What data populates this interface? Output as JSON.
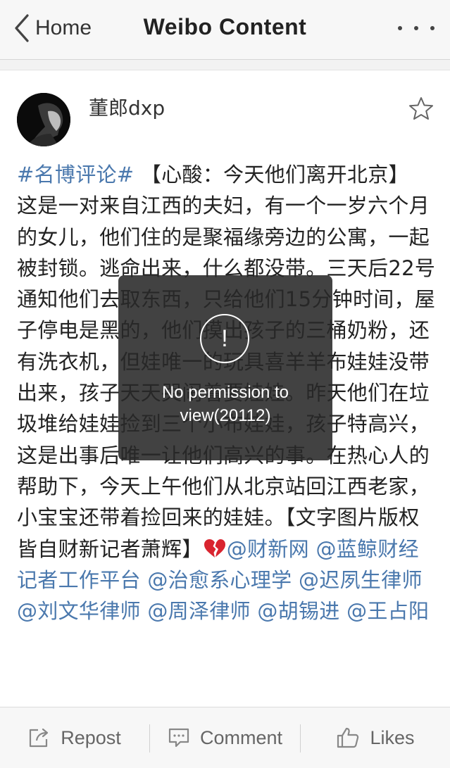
{
  "nav": {
    "back_label": "Home",
    "title": "Weibo Content",
    "more_icon": "more-dots-icon"
  },
  "post": {
    "username": "董郎dxp",
    "hashtag": "#名博评论#",
    "headline": " 【心酸：今天他们离开北京】",
    "body": "这是一对来自江西的夫妇，有一个一岁六个月的女儿，他们住的是聚福缘旁边的公寓，一起被封锁。逃命出来，什么都没带。三天后22号通知他们去取东西，只给他们15分钟时间，屋子停电是黑的，他们摸出孩子的三桶奶粉，还有洗衣机，但娃唯一的玩具喜羊羊布娃娃没带出来，孩子天天哭闹着要娃娃。昨天他们在垃圾堆给娃娃捡到三个小布娃娃，孩子特高兴，这是出事后唯一让他们高兴的事。在热心人的帮助下，今天上午他们从北京站回江西老家，小宝宝还带着捡回来的娃娃。【文字图片版权皆自财新记者萧辉】",
    "emoji": "broken-heart",
    "mentions": [
      "@财新网",
      "@蓝鲸财经记者工作平台",
      "@治愈系心理学",
      "@迟夙生律师",
      "@刘文华律师",
      "@周泽律师",
      "@胡锡进",
      "@王占阳"
    ]
  },
  "toast": {
    "icon": "exclamation-circle-icon",
    "message": "No permission to view(20112)"
  },
  "toolbar": {
    "repost_label": "Repost",
    "comment_label": "Comment",
    "likes_label": "Likes"
  },
  "colors": {
    "link": "#4a78ad",
    "text": "#222222",
    "nav_bg": "#f7f7f7",
    "toast_bg": "#282828"
  }
}
